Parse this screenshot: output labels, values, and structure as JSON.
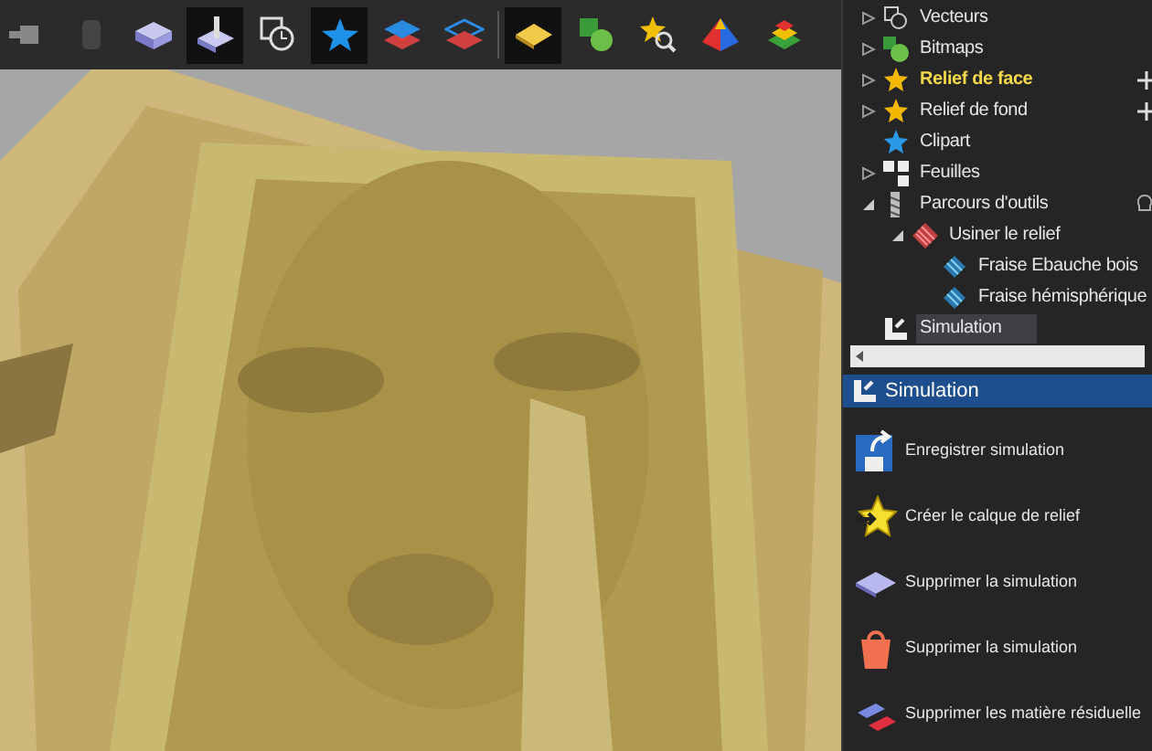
{
  "toolbar": [
    {
      "selected": false,
      "disabled": false
    },
    {
      "selected": false,
      "disabled": true
    },
    {
      "selected": false,
      "disabled": false
    },
    {
      "selected": true,
      "disabled": false
    },
    {
      "selected": false,
      "disabled": false
    },
    {
      "selected": true,
      "disabled": false
    },
    {
      "selected": false,
      "disabled": false
    },
    {
      "selected": false,
      "disabled": false
    },
    {
      "selected": true,
      "disabled": false
    },
    {
      "selected": false,
      "disabled": false
    },
    {
      "selected": false,
      "disabled": false
    },
    {
      "selected": false,
      "disabled": false
    },
    {
      "selected": false,
      "disabled": false
    }
  ],
  "tree": [
    {
      "label": "Vecteurs",
      "kind": "vectors",
      "expanded": false,
      "active": false,
      "selected": false
    },
    {
      "label": "Bitmaps",
      "kind": "bitmaps",
      "expanded": false,
      "active": false,
      "selected": false
    },
    {
      "label": "Relief de face",
      "kind": "star",
      "expanded": false,
      "active": true,
      "selected": false
    },
    {
      "label": "Relief de fond",
      "kind": "star",
      "expanded": false,
      "active": false,
      "selected": false
    },
    {
      "label": "Clipart",
      "kind": "bluestar",
      "active": false,
      "selected": false
    },
    {
      "label": "Feuilles",
      "kind": "sheets",
      "expanded": false,
      "active": false,
      "selected": false
    },
    {
      "label": "Parcours d'outils",
      "kind": "tool",
      "expanded": true,
      "active": false,
      "selected": false,
      "children": [
        {
          "label": "Usiner le relief",
          "kind": "machining",
          "expanded": true,
          "active": false,
          "selected": false,
          "children": [
            {
              "label": "Fraise Ebauche bois",
              "kind": "path",
              "active": false,
              "selected": false
            },
            {
              "label": "Fraise hémisphérique",
              "kind": "path",
              "active": false,
              "selected": false
            }
          ]
        }
      ]
    },
    {
      "label": "Simulation",
      "kind": "simulation",
      "active": false,
      "selected": true
    }
  ],
  "panel": {
    "title": "Simulation"
  },
  "actions": [
    {
      "label": "Enregistrer simulation",
      "kind": "save"
    },
    {
      "label": "Créer le calque de relief",
      "kind": "layer"
    },
    {
      "label": "Supprimer la simulation",
      "kind": "plate"
    },
    {
      "label": "Supprimer la simulation",
      "kind": "bucket"
    },
    {
      "label": "Supprimer les matière résiduelle",
      "kind": "blocks"
    }
  ]
}
